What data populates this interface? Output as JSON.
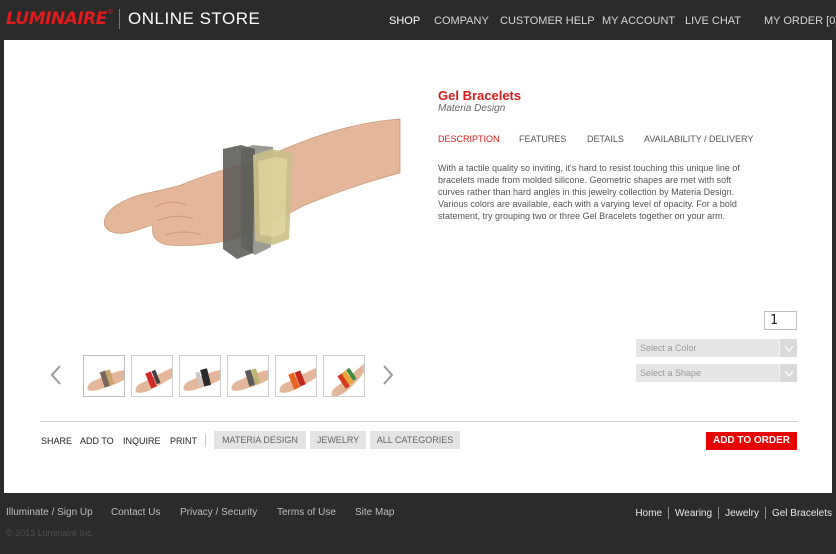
{
  "header": {
    "brand": "LUMINAIRE",
    "store_label": "ONLINE STORE",
    "nav": [
      "SHOP",
      "COMPANY",
      "CUSTOMER HELP",
      "MY ACCOUNT",
      "LIVE CHAT",
      "MY ORDER [0]"
    ],
    "active_nav": "SHOP"
  },
  "product": {
    "title": "Gel Bracelets",
    "brand": "Materia Design",
    "tabs": [
      "DESCRIPTION",
      "FEATURES",
      "DETAILS",
      "AVAILABILITY / DELIVERY"
    ],
    "active_tab": "DESCRIPTION",
    "description": "With a tactile quality so inviting, it's hard to resist touching this unique line of bracelets made from molded silicone. Geometric shapes are met with soft curves rather than hard angles in this jewelry collection by Materia Design. Various colors are available, each with a varying level of opacity. For a bold statement, try grouping two or three Gel Bracelets together on your arm.",
    "quantity": "1",
    "color_select": "Select a Color",
    "shape_select": "Select a Shape"
  },
  "thumbnails": {
    "count": 6,
    "prev_icon": "chevron-left-icon",
    "next_icon": "chevron-right-icon"
  },
  "actions": {
    "share": "SHARE",
    "add_to": "ADD TO",
    "inquire": "INQUIRE",
    "print": "PRINT",
    "categories": [
      "MATERIA DESIGN",
      "JEWELRY",
      "ALL CATEGORIES"
    ],
    "add_to_order": "ADD TO ORDER"
  },
  "footer": {
    "links": [
      "Illuminate / Sign Up",
      "Contact Us",
      "Privacy / Security",
      "Terms of Use",
      "Site Map"
    ],
    "copyright": "© 2013 Luminaire Inc.",
    "breadcrumbs": [
      "Home",
      "Wearing",
      "Jewelry",
      "Gel Bracelets"
    ]
  },
  "colors": {
    "accent": "#d41c1c",
    "button": "#e60000",
    "header_bg": "#2b2b2b"
  }
}
